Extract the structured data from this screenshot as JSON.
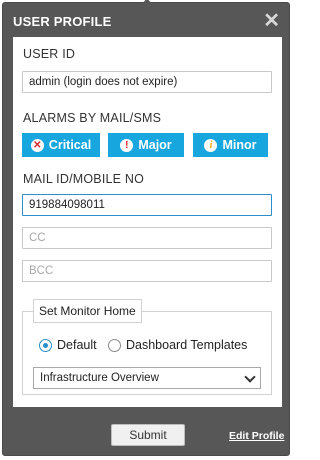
{
  "popup": {
    "title": "USER PROFILE",
    "close_glyph": "✕"
  },
  "user_id": {
    "label": "USER ID",
    "value": "admin (login does not expire)"
  },
  "alarms": {
    "label": "ALARMS BY MAIL/SMS",
    "buttons": [
      {
        "label": "Critical",
        "icon": "x-circle-icon",
        "glyph": "✕"
      },
      {
        "label": "Major",
        "icon": "exclamation-icon",
        "glyph": "!"
      },
      {
        "label": "Minor",
        "icon": "info-icon",
        "glyph": "i"
      }
    ],
    "color": "#18a6df"
  },
  "mail": {
    "label": "MAIL ID/MOBILE NO",
    "to_value": "919884098011",
    "cc_placeholder": "CC",
    "bcc_placeholder": "BCC"
  },
  "monitor_home": {
    "legend": "Set Monitor Home",
    "options": [
      {
        "label": "Default",
        "selected": true
      },
      {
        "label": "Dashboard Templates",
        "selected": false
      }
    ],
    "select_value": "Infrastructure Overview"
  },
  "footer": {
    "submit_label": "Submit",
    "edit_link": "Edit Profile"
  }
}
